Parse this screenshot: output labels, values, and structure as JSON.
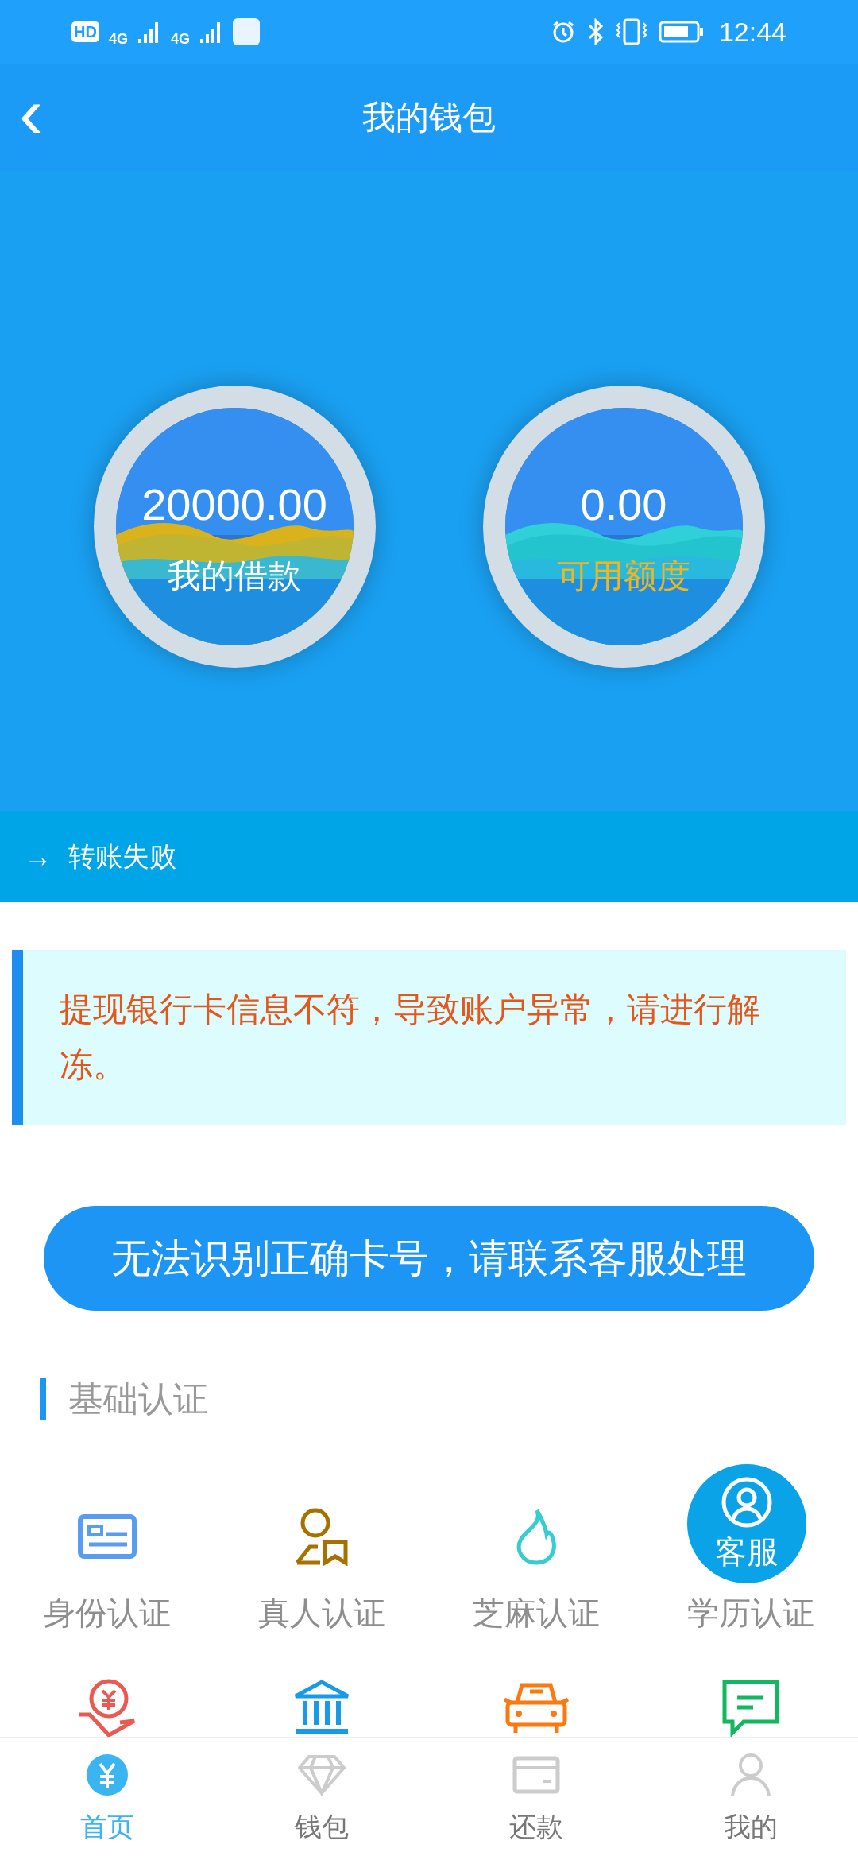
{
  "status_bar": {
    "indicators": [
      "HD",
      "4G",
      "4G"
    ],
    "time": "12:44"
  },
  "header": {
    "back": "‹",
    "title": "我的钱包"
  },
  "balances": [
    {
      "amount": "20000.00",
      "label": "我的借款",
      "kind": "gold"
    },
    {
      "amount": "0.00",
      "label": "可用额度",
      "kind": "teal"
    }
  ],
  "status_strip": {
    "arrow": "→",
    "text": "转账失败"
  },
  "notice": "提现银行卡信息不符，导致账户异常，请进行解冻。",
  "action_button": "无法识别正确卡号，请联系客服处理",
  "section_title": "基础认证",
  "verifications": [
    {
      "label": "身份认证",
      "kind": "id-card"
    },
    {
      "label": "真人认证",
      "kind": "person"
    },
    {
      "label": "芝麻认证",
      "kind": "flame"
    },
    {
      "label": "学历认证",
      "kind": "none"
    },
    {
      "kind": "coin-hand"
    },
    {
      "kind": "bank"
    },
    {
      "kind": "car"
    },
    {
      "kind": "chat"
    }
  ],
  "support_button": "客服",
  "tabs": [
    {
      "label": "首页",
      "kind": "yen",
      "selected": true
    },
    {
      "label": "钱包",
      "kind": "diamond",
      "selected": false
    },
    {
      "label": "还款",
      "kind": "card",
      "selected": false
    },
    {
      "label": "我的",
      "kind": "user",
      "selected": false
    }
  ]
}
